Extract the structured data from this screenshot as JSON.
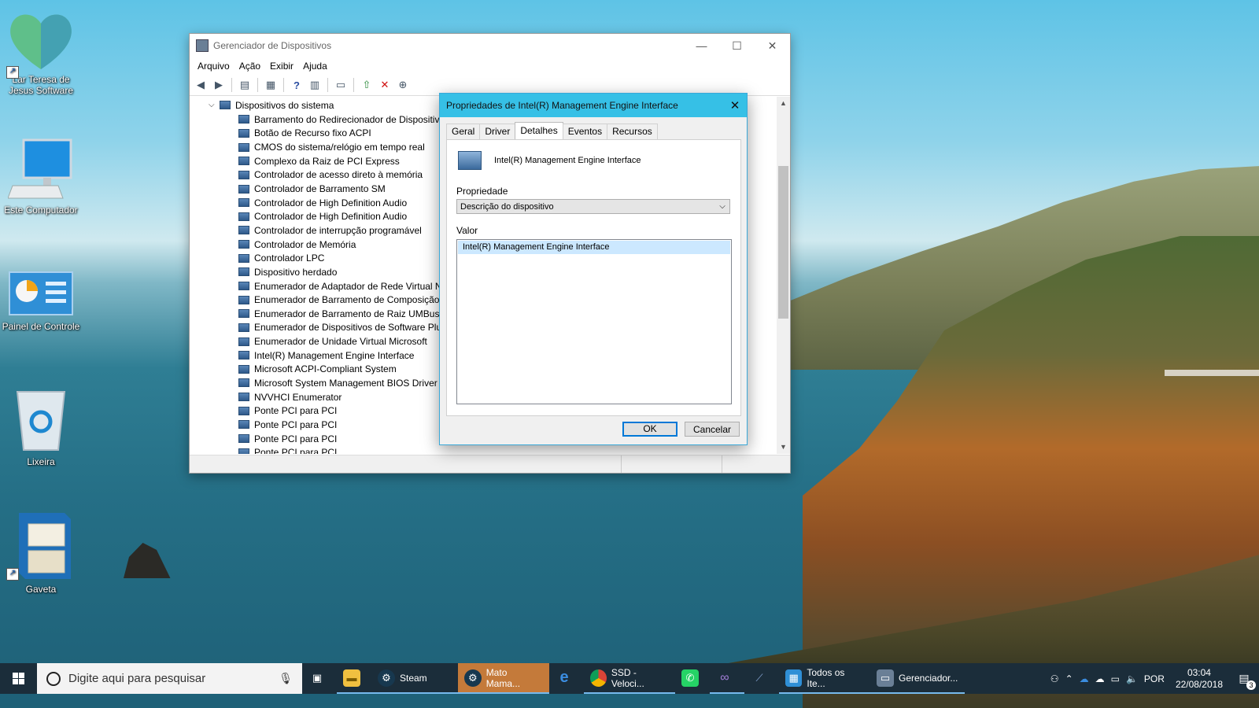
{
  "desktop": {
    "icons": [
      {
        "label": "Lar Teresa de Jesus Software"
      },
      {
        "label": "Este Computador"
      },
      {
        "label": "Painel de Controle"
      },
      {
        "label": "Lixeira"
      },
      {
        "label": "Gaveta"
      }
    ]
  },
  "device_manager": {
    "title": "Gerenciador de Dispositivos",
    "menu": [
      "Arquivo",
      "Ação",
      "Exibir",
      "Ajuda"
    ],
    "tree_root": "Dispositivos do sistema",
    "devices": [
      "Barramento do Redirecionador de Dispositivos",
      "Botão de Recurso fixo ACPI",
      "CMOS do sistema/relógio em tempo real",
      "Complexo da Raiz de PCI Express",
      "Controlador de acesso direto à memória",
      "Controlador de Barramento SM",
      "Controlador de High Definition Audio",
      "Controlador de High Definition Audio",
      "Controlador de interrupção programável",
      "Controlador de Memória",
      "Controlador LPC",
      "Dispositivo herdado",
      "Enumerador de Adaptador de Rede Virtual ND",
      "Enumerador de Barramento de Composição",
      "Enumerador de Barramento de Raiz UMBus",
      "Enumerador de Dispositivos de Software Plug",
      "Enumerador de Unidade Virtual Microsoft",
      "Intel(R) Management Engine Interface",
      "Microsoft ACPI-Compliant System",
      "Microsoft System Management BIOS Driver",
      "NVVHCI Enumerator",
      "Ponte PCI para PCI",
      "Ponte PCI para PCI",
      "Ponte PCI para PCI",
      "Ponte PCI para PCI"
    ]
  },
  "dialog": {
    "title": "Propriedades de Intel(R) Management Engine Interface",
    "tabs": [
      "Geral",
      "Driver",
      "Detalhes",
      "Eventos",
      "Recursos"
    ],
    "active_tab": "Detalhes",
    "device_name": "Intel(R) Management Engine Interface",
    "property_label": "Propriedade",
    "property_value": "Descrição do dispositivo",
    "value_label": "Valor",
    "value_item": "Intel(R) Management Engine Interface",
    "ok_label": "OK",
    "cancel_label": "Cancelar"
  },
  "taskbar": {
    "search_placeholder": "Digite aqui para pesquisar",
    "apps": [
      {
        "label": "Steam"
      },
      {
        "label": "Mato Mama..."
      },
      {
        "label": "SSD - Veloci..."
      },
      {
        "label": "Todos os Ite..."
      },
      {
        "label": "Gerenciador..."
      }
    ],
    "language": "POR",
    "time": "03:04",
    "date": "22/08/2018",
    "notifications": "3"
  }
}
